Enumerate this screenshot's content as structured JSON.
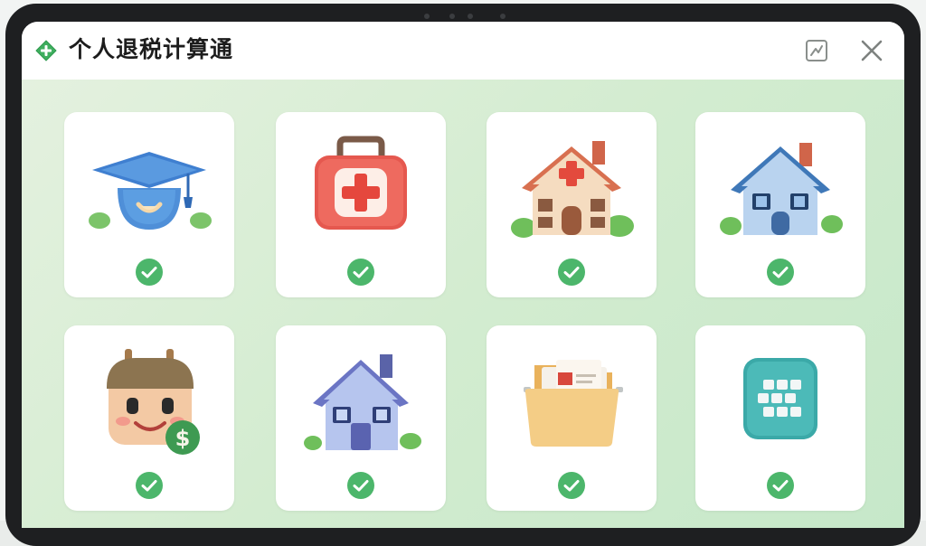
{
  "app": {
    "title": "个人退税计算通",
    "logo_icon": "green-plus-diamond-icon",
    "accent_color": "#3fae5f"
  },
  "titlebar": {
    "buttons": [
      {
        "icon": "minimize-window-icon"
      },
      {
        "icon": "close-icon"
      }
    ]
  },
  "grid": {
    "tiles": [
      {
        "icon": "graduation-cap-icon",
        "checked": true
      },
      {
        "icon": "medical-kit-icon",
        "checked": true
      },
      {
        "icon": "house-with-cross-icon",
        "checked": true
      },
      {
        "icon": "blue-house-icon",
        "checked": true
      },
      {
        "icon": "elderly-care-money-icon",
        "checked": true
      },
      {
        "icon": "rental-house-icon",
        "checked": true
      },
      {
        "icon": "folder-documents-icon",
        "checked": true
      },
      {
        "icon": "teal-grid-app-icon",
        "checked": true
      }
    ],
    "check_color": "#4cb66b"
  }
}
